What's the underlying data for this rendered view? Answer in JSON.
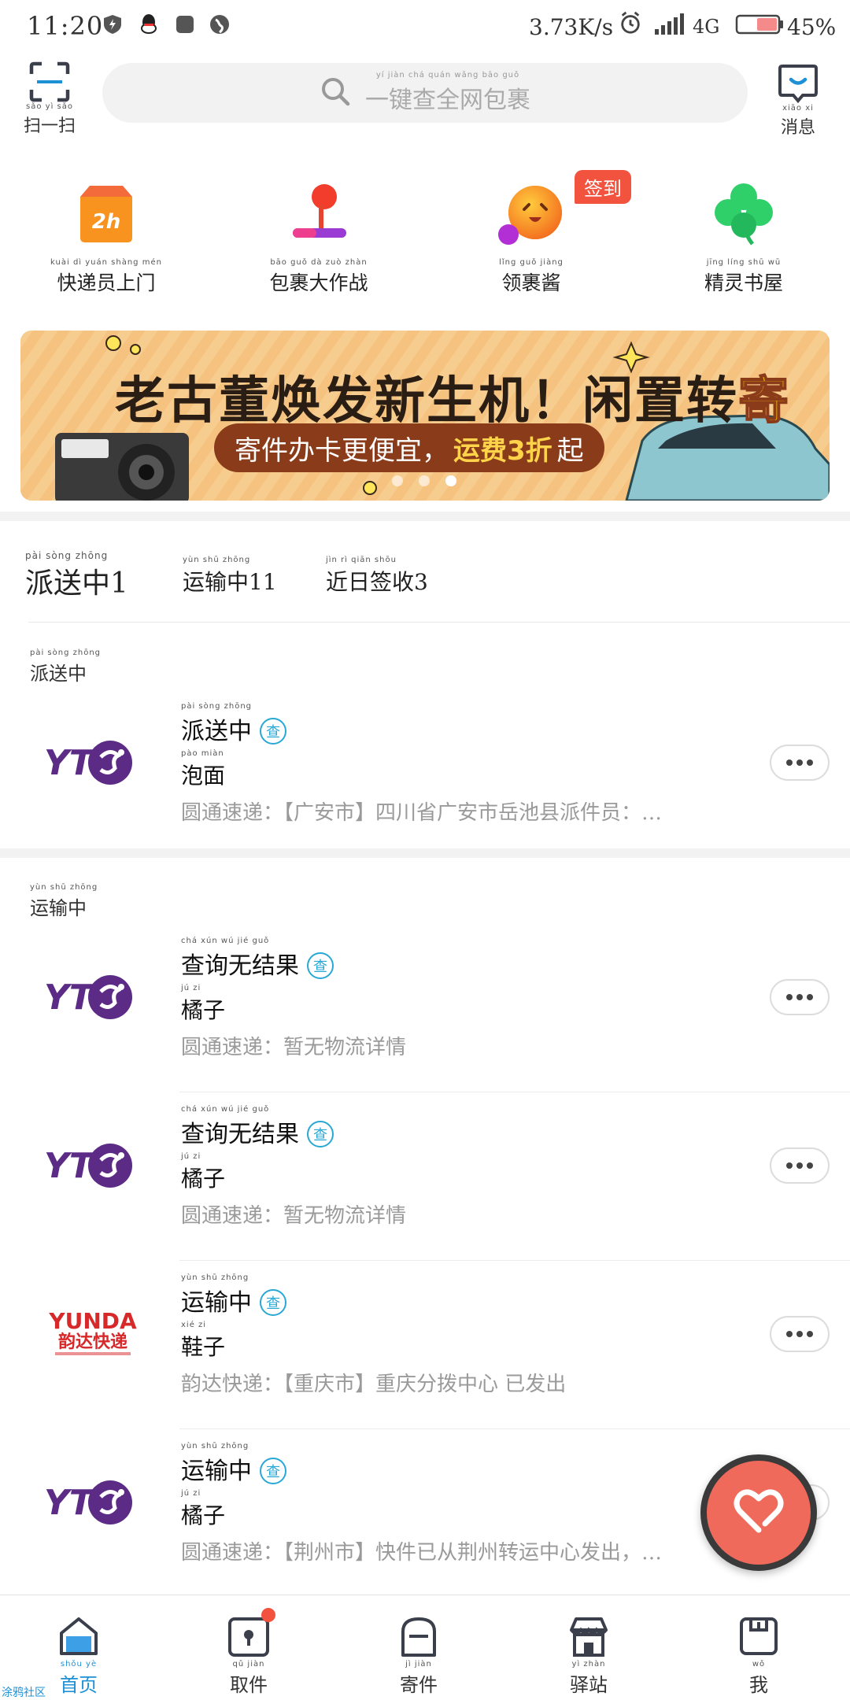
{
  "status_bar": {
    "time": "11:20",
    "net_speed": "3.73K/s",
    "network": "4G",
    "battery": "45%"
  },
  "header": {
    "scan": {
      "pinyin": "sǎo yì sǎo",
      "label": "扫一扫"
    },
    "search": {
      "pinyin": "yí jiàn chá quán wǎng bāo guǒ",
      "placeholder": "一键查全网包裹"
    },
    "message": {
      "pinyin": "xiāo xi",
      "label": "消息"
    }
  },
  "quick_entries": [
    {
      "pinyin": "kuài dì yuán shàng mén",
      "label": "快递员上门",
      "icon": "courier-2h-icon"
    },
    {
      "pinyin": "bāo guǒ dà zuò zhàn",
      "label": "包裹大作战",
      "icon": "joystick-icon"
    },
    {
      "pinyin": "lǐng guǒ jiàng",
      "label": "领裹酱",
      "icon": "mascot-icon",
      "badge": "签到"
    },
    {
      "pinyin": "jīng líng shū wū",
      "label": "精灵书屋",
      "icon": "clover-icon"
    }
  ],
  "banner": {
    "title_prefix": "老古董焕发新生机！闲置转",
    "title_highlight": "寄",
    "pill_prefix": "寄件办卡更便宜，",
    "pill_highlight": "运费3折",
    "pill_suffix": "起",
    "page_count": 3,
    "active_page": 3
  },
  "summary_tabs": [
    {
      "pinyin": "pài sòng zhōng",
      "label": "派送中1"
    },
    {
      "pinyin": "yùn shū zhōng",
      "label": "运输中11"
    },
    {
      "pinyin": "jìn rì qiān shōu",
      "label": "近日签收3"
    }
  ],
  "sections": [
    {
      "pinyin": "pài sòng zhōng",
      "title": "派送中",
      "items": [
        {
          "carrier": "YTO",
          "status_pinyin": "pài sòng zhōng",
          "status": "派送中",
          "check": "查",
          "name_pinyin": "pào miàn",
          "name": "泡面",
          "desc": "圆通速递：【广安市】四川省广安市岳池县派件员：…"
        }
      ]
    },
    {
      "pinyin": "yùn shū zhōng",
      "title": "运输中",
      "items": [
        {
          "carrier": "YTO",
          "status_pinyin": "chá xún wú jié guǒ",
          "status": "查询无结果",
          "check": "查",
          "name_pinyin": "jú zi",
          "name": "橘子",
          "desc": "圆通速递：暂无物流详情"
        },
        {
          "carrier": "YTO",
          "status_pinyin": "chá xún wú jié guǒ",
          "status": "查询无结果",
          "check": "查",
          "name_pinyin": "jú zi",
          "name": "橘子",
          "desc": "圆通速递：暂无物流详情"
        },
        {
          "carrier": "YUNDA",
          "carrier_cn": "韵达快递",
          "status_pinyin": "yùn shū zhōng",
          "status": "运输中",
          "check": "查",
          "name_pinyin": "xié zi",
          "name": "鞋子",
          "desc": "韵达快递：【重庆市】重庆分拨中心 已发出"
        },
        {
          "carrier": "YTO",
          "status_pinyin": "yùn shū zhōng",
          "status": "运输中",
          "check": "查",
          "name_pinyin": "jú zi",
          "name": "橘子",
          "desc": "圆通速递：【荆州市】快件已从荆州转运中心发出，…"
        }
      ]
    }
  ],
  "bottom_nav": [
    {
      "pinyin": "shǒu yè",
      "label": "首页",
      "active": true
    },
    {
      "pinyin": "qǔ jiàn",
      "label": "取件",
      "badge": true
    },
    {
      "pinyin": "jì jiàn",
      "label": "寄件"
    },
    {
      "pinyin": "yì zhàn",
      "label": "驿站"
    },
    {
      "pinyin": "wǒ",
      "label": "我"
    }
  ],
  "community_label": "涂鸦社区",
  "colors": {
    "accent": "#1e90d6",
    "check": "#29a8d6",
    "badge": "#f2533f",
    "fab": "#ef6a5a",
    "yto": "#5b2b86",
    "yunda": "#d7282a"
  }
}
